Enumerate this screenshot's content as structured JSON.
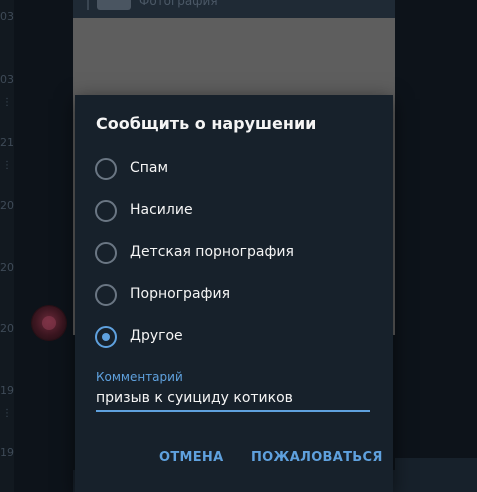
{
  "background": {
    "times": [
      "03",
      "03",
      "21",
      "20",
      "20",
      "20",
      "19",
      "19"
    ],
    "photo_caption": "Фотография"
  },
  "dialog": {
    "title": "Сообщить о нарушении",
    "options": [
      {
        "label": "Спам",
        "checked": false
      },
      {
        "label": "Насилие",
        "checked": false
      },
      {
        "label": "Детская порнография",
        "checked": false
      },
      {
        "label": "Порнография",
        "checked": false
      },
      {
        "label": "Другое",
        "checked": true
      }
    ],
    "comment": {
      "label": "Комментарий",
      "value": "призыв к суициду котиков"
    },
    "buttons": {
      "cancel": "ОТМЕНА",
      "report": "ПОЖАЛОВАТЬСЯ"
    }
  },
  "colors": {
    "accent": "#5fa1de",
    "dialog_bg": "#17212b",
    "text": "#f5f5f5"
  }
}
